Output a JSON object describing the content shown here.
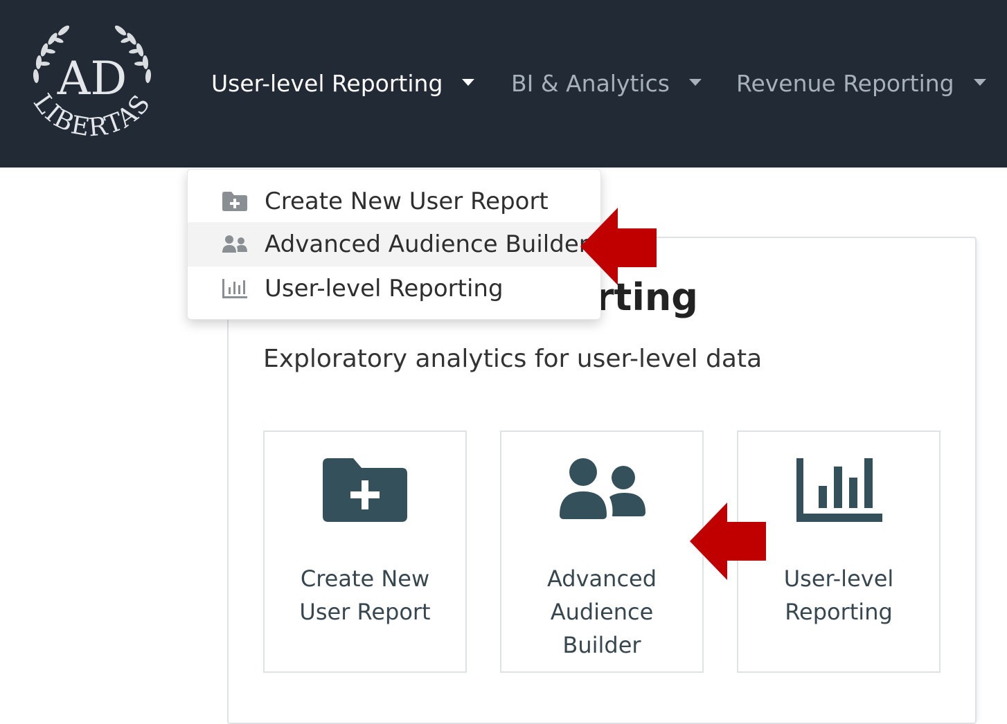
{
  "brand": {
    "logo_letters": "AD",
    "logo_word": "LIBERTAS"
  },
  "navbar": {
    "items": [
      {
        "label": "User-level Reporting",
        "active": true
      },
      {
        "label": "BI & Analytics",
        "active": false
      },
      {
        "label": "Revenue Reporting",
        "active": false
      }
    ]
  },
  "dropdown": {
    "items": [
      {
        "label": "Create New User Report",
        "icon": "folder-plus-icon"
      },
      {
        "label": "Advanced Audience Builder",
        "icon": "users-icon",
        "hovered": true
      },
      {
        "label": "User-level Reporting",
        "icon": "bar-chart-icon"
      }
    ]
  },
  "page": {
    "title": "User-level Reporting",
    "subtitle": "Exploratory analytics for user-level data"
  },
  "tiles": [
    {
      "label": "Create New User Report",
      "icon": "folder-plus-icon"
    },
    {
      "label": "Advanced Audience Builder",
      "icon": "users-icon"
    },
    {
      "label": "User-level Reporting",
      "icon": "bar-chart-icon"
    }
  ],
  "colors": {
    "navbar_bg": "#222a35",
    "icon_color": "#33505b",
    "annotation_arrow": "#c00000"
  }
}
